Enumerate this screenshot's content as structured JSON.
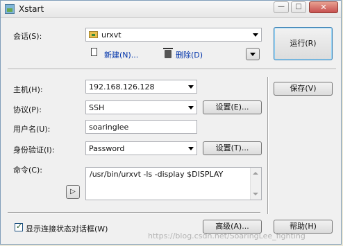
{
  "window": {
    "title": "Xstart",
    "minimize_glyph": "—",
    "maximize_glyph": "□",
    "close_glyph": "✕"
  },
  "session": {
    "label": "会话(S):",
    "value": "urxvt",
    "new_label": "新建(N)...",
    "delete_label": "删除(D)",
    "run_label": "运行(R)"
  },
  "host": {
    "label": "主机(H):",
    "value": "192.168.126.128",
    "save_label": "保存(V)"
  },
  "protocol": {
    "label": "协议(P):",
    "value": "SSH",
    "settings_label": "设置(E)..."
  },
  "username": {
    "label": "用户名(U):",
    "value": "soaringlee"
  },
  "auth": {
    "label": "身份验证(I):",
    "value": "Password",
    "settings_label": "设置(T)..."
  },
  "command": {
    "label": "命令(C):",
    "value": "/usr/bin/urxvt  -ls -display $DISPLAY",
    "arrow_glyph": "▷"
  },
  "footer": {
    "show_status_label": "显示连接状态对话框(W)",
    "show_status_checked": true,
    "advanced_label": "高级(A)...",
    "help_label": "帮助(H)",
    "watermark": "https://blog.csdn.net/SoaringLee_fighting"
  }
}
